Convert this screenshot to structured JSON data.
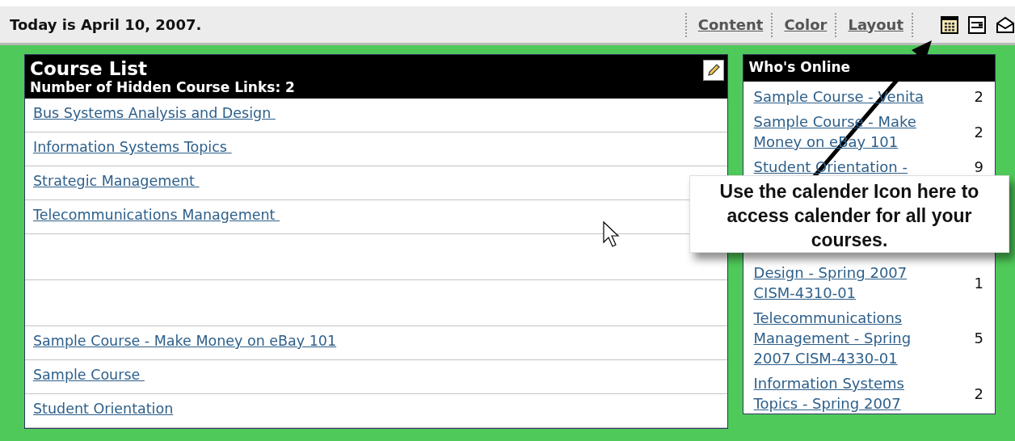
{
  "top_bar": {
    "date": "Today is April 10, 2007.",
    "links": [
      "Content",
      "Color",
      "Layout"
    ]
  },
  "course_list": {
    "title": "Course List",
    "subtitle": "Number of Hidden Course Links: 2",
    "rows": [
      {
        "kind": "link",
        "label": "Bus Systems Analysis and Design "
      },
      {
        "kind": "link",
        "label": "Information Systems Topics "
      },
      {
        "kind": "link",
        "label": "Strategic Management "
      },
      {
        "kind": "link",
        "label": "Telecommunications Management "
      },
      {
        "kind": "blank"
      },
      {
        "kind": "blank"
      },
      {
        "kind": "link",
        "label": "Sample Course - Make Money on eBay 101"
      },
      {
        "kind": "link",
        "label": "Sample Course "
      },
      {
        "kind": "link",
        "label": "Student Orientation"
      }
    ]
  },
  "whos_online": {
    "title": "Who's Online",
    "items": [
      {
        "label": "Sample Course - Venita",
        "count": "2"
      },
      {
        "label": "Sample Course - Make Money on eBay 101",
        "count": "2"
      },
      {
        "label": "Student Orientation -",
        "count": "9"
      },
      {
        "label": "Design - Spring 2007 CISM-4310-01",
        "count": "1"
      },
      {
        "label": "Telecommunications Management - Spring 2007 CISM-4330-01",
        "count": "5"
      },
      {
        "label": "Information Systems Topics - Spring 2007",
        "count": "2"
      }
    ]
  },
  "callout": {
    "text": "Use the calender Icon here to access calender for all your courses."
  }
}
